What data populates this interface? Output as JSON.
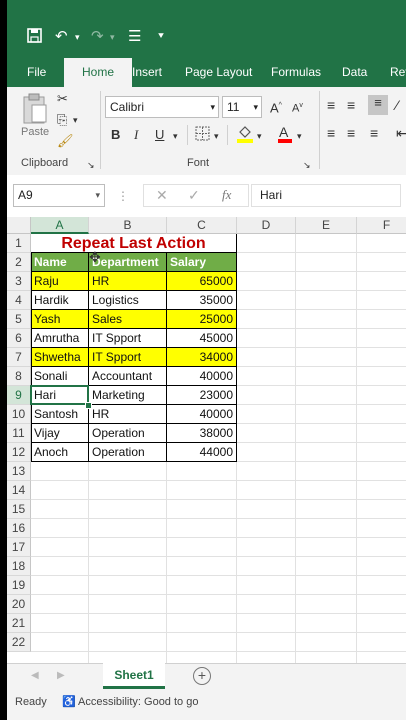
{
  "ribbon_tabs": [
    "File",
    "Home",
    "Insert",
    "Page Layout",
    "Formulas",
    "Data",
    "Rev"
  ],
  "active_tab": "Home",
  "ribbon": {
    "paste_label": "Paste",
    "clipboard_label": "Clipboard",
    "font_label": "Font",
    "font_name": "Calibri",
    "font_size": "11",
    "bold": "B",
    "italic": "I",
    "underline": "U"
  },
  "formula_bar": {
    "name_box": "A9",
    "content": "Hari"
  },
  "columns": [
    "A",
    "B",
    "C",
    "D",
    "E",
    "F"
  ],
  "selected_cell": "A9",
  "title_text": "Repeat Last Action",
  "table": {
    "headers": [
      "Name",
      "Department",
      "Salary"
    ],
    "rows": [
      {
        "name": "Raju",
        "dept": "HR",
        "salary": "65000",
        "highlight": true
      },
      {
        "name": "Hardik",
        "dept": "Logistics",
        "salary": "35000",
        "highlight": false
      },
      {
        "name": "Yash",
        "dept": "Sales",
        "salary": "25000",
        "highlight": true
      },
      {
        "name": "Amrutha",
        "dept": "IT Spport",
        "salary": "45000",
        "highlight": false
      },
      {
        "name": "Shwetha",
        "dept": "IT Spport",
        "salary": "34000",
        "highlight": true
      },
      {
        "name": "Sonali",
        "dept": "Accountant",
        "salary": "40000",
        "highlight": false
      },
      {
        "name": "Hari",
        "dept": "Marketing",
        "salary": "23000",
        "highlight": false
      },
      {
        "name": "Santosh",
        "dept": "HR",
        "salary": "40000",
        "highlight": false
      },
      {
        "name": "Vijay",
        "dept": "Operation",
        "salary": "38000",
        "highlight": false
      },
      {
        "name": "Anoch",
        "dept": "Operation",
        "salary": "44000",
        "highlight": false
      }
    ]
  },
  "row_numbers": [
    "1",
    "2",
    "3",
    "4",
    "5",
    "6",
    "7",
    "8",
    "9",
    "10",
    "11",
    "12",
    "13",
    "14",
    "15",
    "16",
    "17",
    "18",
    "19",
    "20",
    "21",
    "22"
  ],
  "sheet_tab": "Sheet1",
  "status": {
    "ready": "Ready",
    "accessibility": "Accessibility: Good to go"
  },
  "colors": {
    "excel_green": "#217346",
    "header_fill": "#70ad47",
    "highlight_fill": "#ffff00",
    "title_red": "#c00000"
  }
}
